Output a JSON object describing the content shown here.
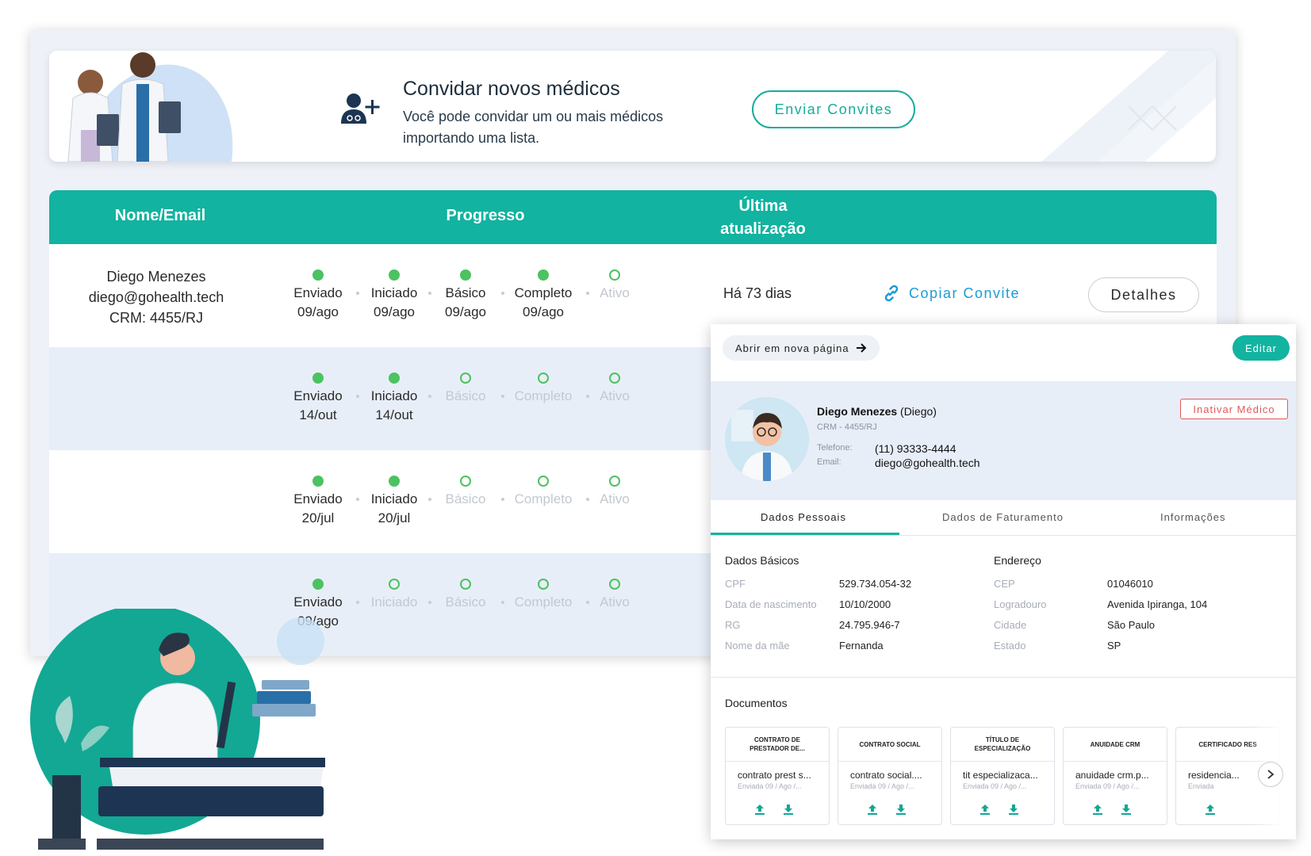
{
  "invite": {
    "title": "Convidar novos médicos",
    "description": "Você pode convidar um ou mais médicos importando uma lista.",
    "button_label": "Enviar Convites",
    "icon": "add-doctor-icon"
  },
  "table": {
    "headers": {
      "name": "Nome/Email",
      "progress": "Progresso",
      "last_update": "Última atualização"
    },
    "rows": [
      {
        "name": "Diego Menezes",
        "email": "diego@gohealth.tech",
        "crm": "CRM: 4455/RJ",
        "steps": [
          {
            "label": "Enviado",
            "date": "09/ago",
            "done": true
          },
          {
            "label": "Iniciado",
            "date": "09/ago",
            "done": true
          },
          {
            "label": "Básico",
            "date": "09/ago",
            "done": true
          },
          {
            "label": "Completo",
            "date": "09/ago",
            "done": true
          },
          {
            "label": "Ativo",
            "date": "",
            "done": false
          }
        ],
        "last_update": "Há 73 dias",
        "copy_label": "Copiar Convite",
        "details_label": "Detalhes"
      },
      {
        "steps": [
          {
            "label": "Enviado",
            "date": "14/out",
            "done": true
          },
          {
            "label": "Iniciado",
            "date": "14/out",
            "done": true
          },
          {
            "label": "Básico",
            "date": "",
            "done": false
          },
          {
            "label": "Completo",
            "date": "",
            "done": false
          },
          {
            "label": "Ativo",
            "date": "",
            "done": false
          }
        ]
      },
      {
        "steps": [
          {
            "label": "Enviado",
            "date": "20/jul",
            "done": true
          },
          {
            "label": "Iniciado",
            "date": "20/jul",
            "done": true
          },
          {
            "label": "Básico",
            "date": "",
            "done": false
          },
          {
            "label": "Completo",
            "date": "",
            "done": false
          },
          {
            "label": "Ativo",
            "date": "",
            "done": false
          }
        ]
      },
      {
        "steps": [
          {
            "label": "Enviado",
            "date": "09/ago",
            "done": true
          },
          {
            "label": "Iniciado",
            "date": "",
            "done": false
          },
          {
            "label": "Básico",
            "date": "",
            "done": false
          },
          {
            "label": "Completo",
            "date": "",
            "done": false
          },
          {
            "label": "Ativo",
            "date": "",
            "done": false
          }
        ]
      }
    ]
  },
  "detail": {
    "open_new_label": "Abrir em nova página",
    "edit_label": "Editar",
    "name": "Diego Menezes",
    "nickname": "(Diego)",
    "crm": "CRM - 4455/RJ",
    "phone_label": "Telefone:",
    "phone": "(11) 93333-4444",
    "email_label": "Email:",
    "email": "diego@gohealth.tech",
    "inactivate_label": "Inativar Médico",
    "tabs": [
      "Dados Pessoais",
      "Dados de Faturamento",
      "Informações"
    ],
    "basic": {
      "title": "Dados Básicos",
      "cpf_label": "CPF",
      "cpf": "529.734.054-32",
      "birth_label": "Data de nascimento",
      "birth": "10/10/2000",
      "rg_label": "RG",
      "rg": "24.795.946-7",
      "mother_label": "Nome da mãe",
      "mother": "Fernanda"
    },
    "address": {
      "title": "Endereço",
      "cep_label": "CEP",
      "cep": "01046010",
      "street_label": "Logradouro",
      "street": "Avenida Ipiranga, 104",
      "city_label": "Cidade",
      "city": "São Paulo",
      "state_label": "Estado",
      "state": "SP"
    },
    "documents_title": "Documentos",
    "documents": [
      {
        "title": "CONTRATO DE PRESTADOR DE...",
        "file": "contrato prest s...",
        "sent": "Enviada 09 / Ago /..."
      },
      {
        "title": "CONTRATO SOCIAL",
        "file": "contrato social....",
        "sent": "Enviada 09 / Ago /..."
      },
      {
        "title": "TÍTULO DE ESPECIALIZAÇÃO",
        "file": "tit especializaca...",
        "sent": "Enviada 09 / Ago /..."
      },
      {
        "title": "ANUIDADE CRM",
        "file": "anuidade crm.p...",
        "sent": "Enviada 09 / Ago /..."
      },
      {
        "title": "CERTIFICADO RES",
        "file": "residencia...",
        "sent": "Enviada"
      }
    ]
  },
  "colors": {
    "accent": "#12b3a0",
    "link": "#1a9bd8",
    "step_done": "#4cc261",
    "danger": "#e05a5a"
  }
}
